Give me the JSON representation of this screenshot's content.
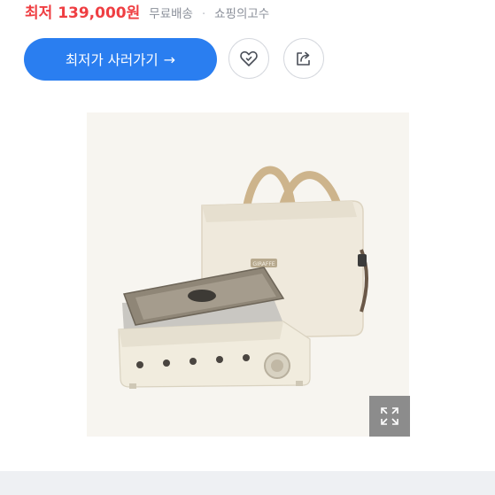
{
  "price_row": {
    "price": "최저 139,000원",
    "shipping": "무료배송",
    "separator": "·",
    "mall": "쇼핑의고수"
  },
  "actions": {
    "buy_label": "최저가 사러가기",
    "buy_arrow": "→",
    "wish_icon": "heart-icon",
    "share_icon": "share-icon"
  },
  "product": {
    "image_icon": "product-photo",
    "brand_logo_text": "GIRAFFE",
    "expand_icon": "expand-icon"
  },
  "colors": {
    "price": "#ef3e42",
    "accent": "#2a7ef0",
    "muted": "#8a8f99",
    "overlay": "#8c8c8c"
  }
}
